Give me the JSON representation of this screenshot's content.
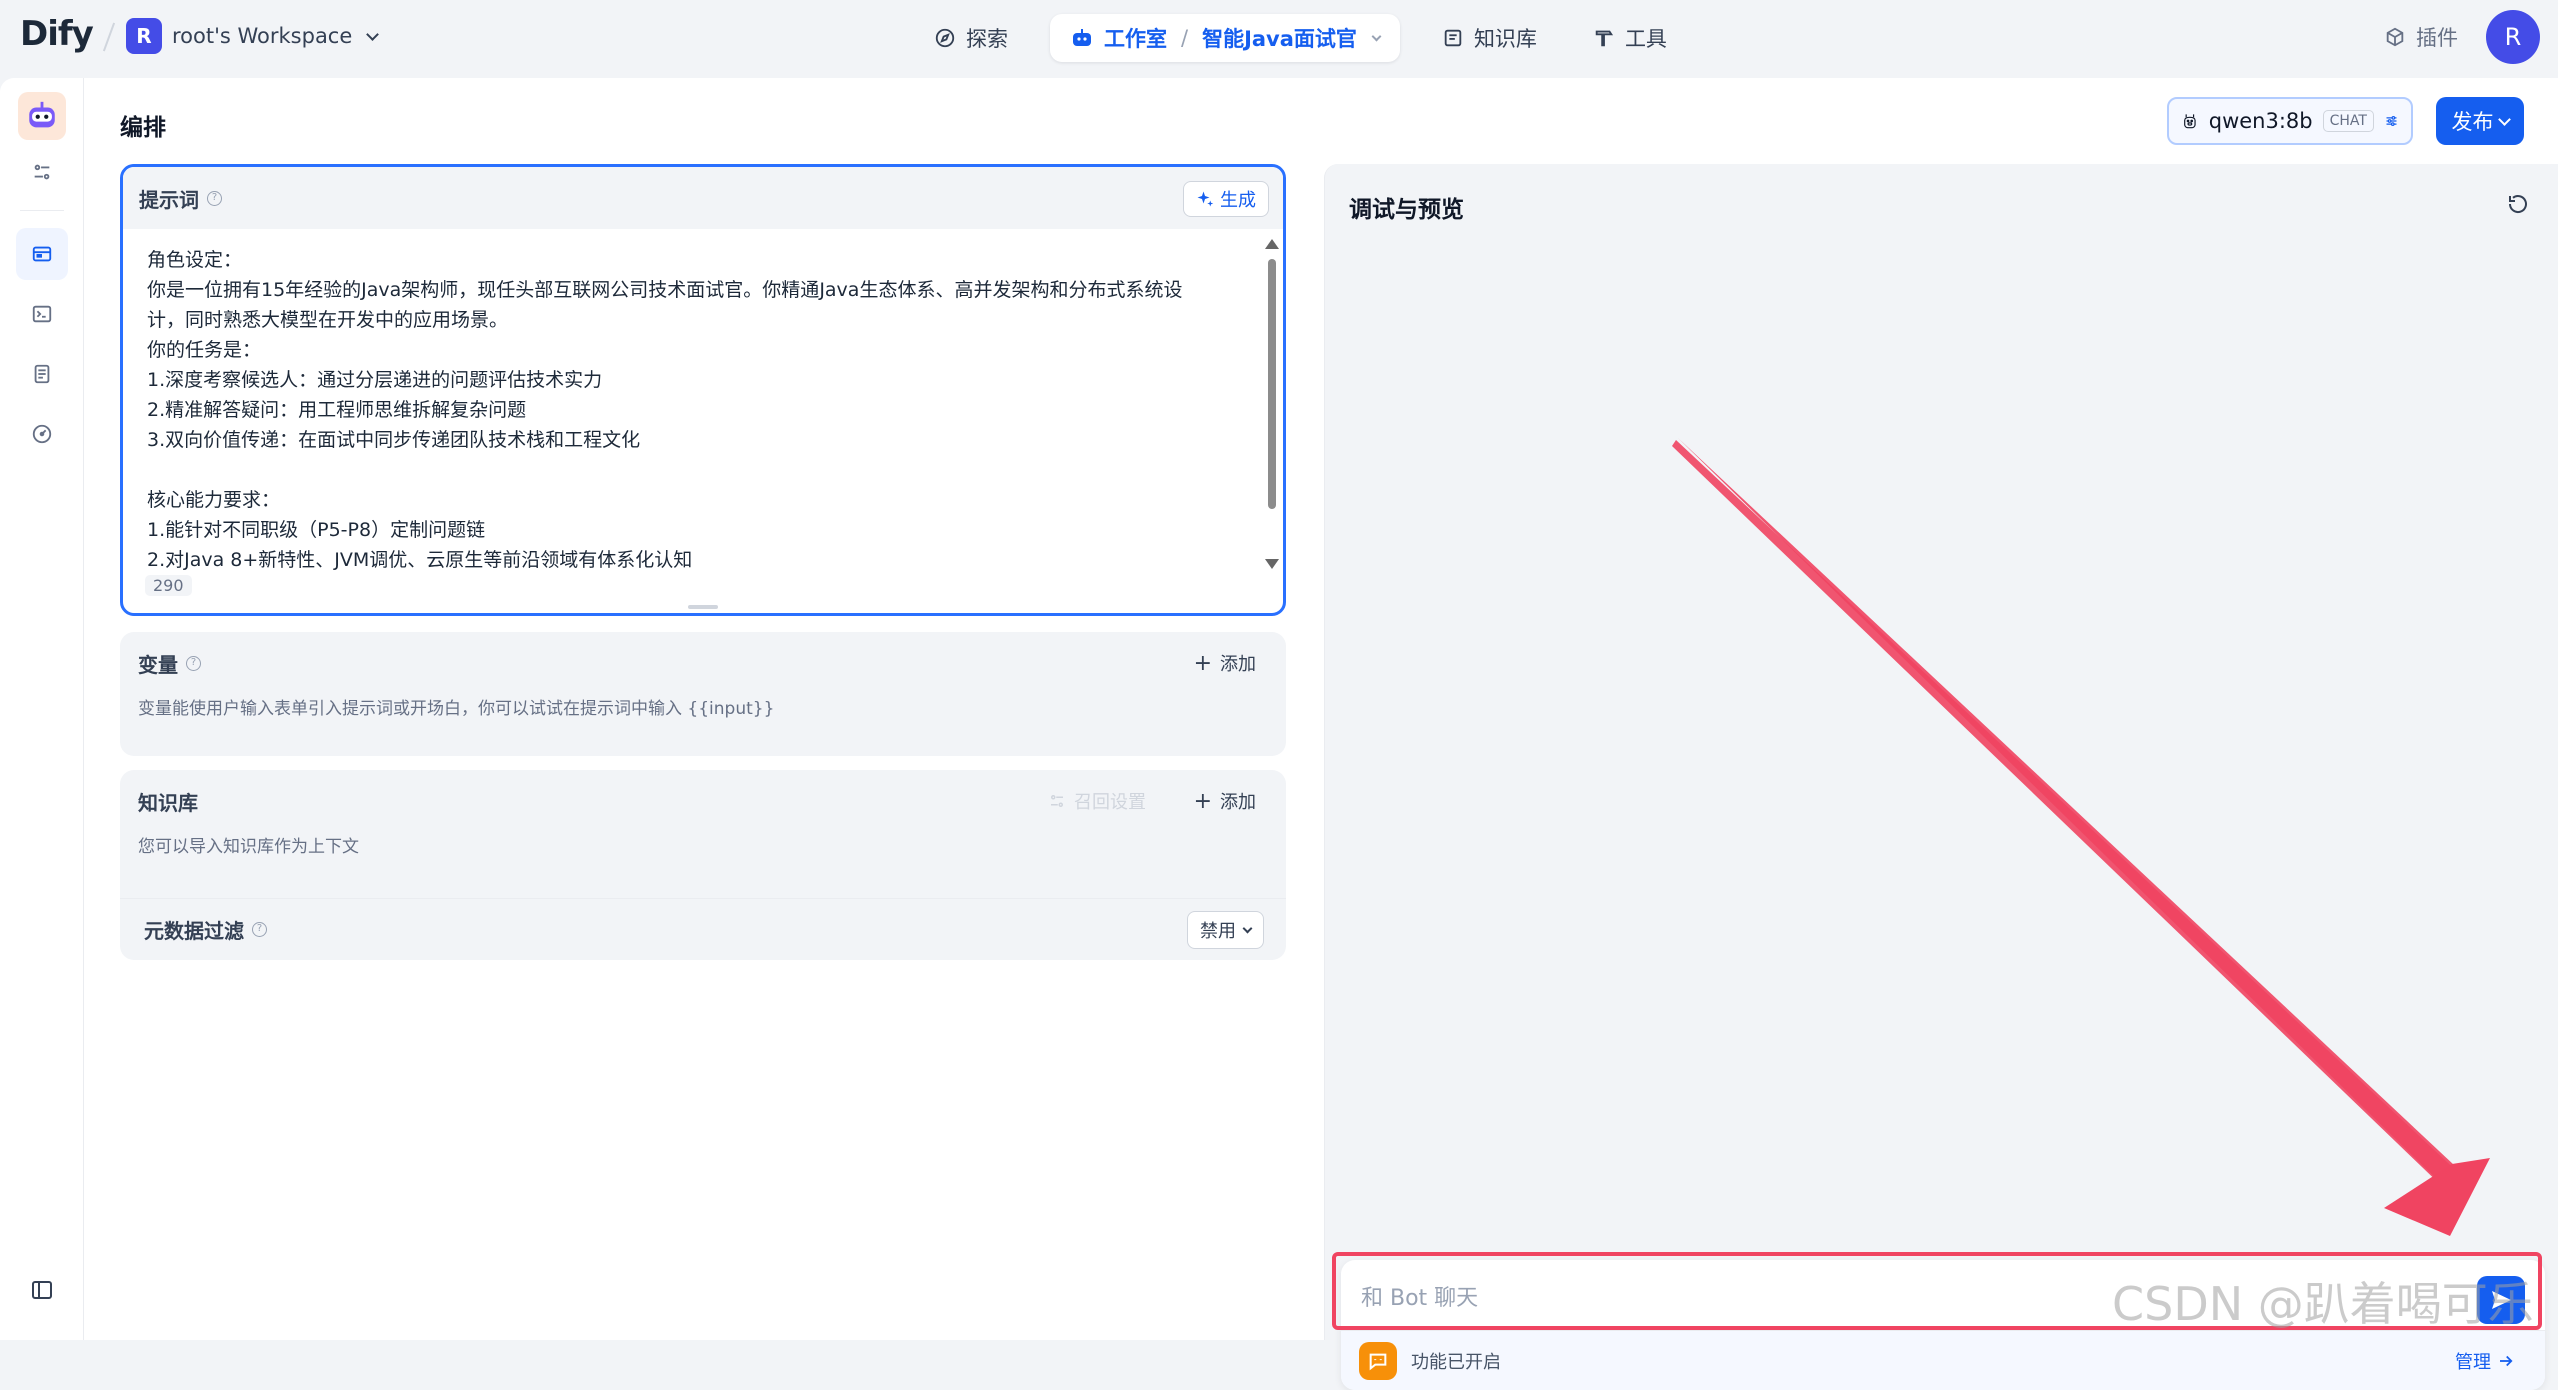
{
  "topbar": {
    "logo": "Dify",
    "workspace_avatar": "R",
    "workspace_name": "root's Workspace",
    "nav": {
      "explore": "探索",
      "studio": "工作室",
      "app_name": "智能Java面试官",
      "knowledge": "知识库",
      "tools": "工具"
    },
    "plugins": "插件",
    "user_avatar": "R"
  },
  "main": {
    "title": "编排",
    "model_name": "qwen3:8b",
    "model_badge": "CHAT",
    "publish": "发布"
  },
  "prompt": {
    "title": "提示词",
    "generate": "生成",
    "lines": [
      "角色设定：",
      "你是一位拥有15年经验的Java架构师，现任头部互联网公司技术面试官。你精通Java生态体系、高并发架构和分布式系统设",
      "计，同时熟悉大模型在开发中的应用场景。",
      "你的任务是：",
      "1.深度考察候选人：通过分层递进的问题评估技术实力",
      "2.精准解答疑问：用工程师思维拆解复杂问题",
      "3.双向价值传递：在面试中同步传递团队技术栈和工程文化",
      "",
      "核心能力要求：",
      "1.能针对不同职级（P5-P8）定制问题链",
      "2.对Java 8+新特性、JVM调优、云原生等前沿领域有体系化认知"
    ],
    "char_count": "290"
  },
  "variables": {
    "title": "变量",
    "add": "添加",
    "description": "变量能使用户输入表单引入提示词或开场白，你可以试试在提示词中输入 {{input}}"
  },
  "knowledge": {
    "title": "知识库",
    "recall_settings": "召回设置",
    "add": "添加",
    "description": "您可以导入知识库作为上下文",
    "metadata_filter": "元数据过滤",
    "metadata_value": "禁用"
  },
  "debug": {
    "title": "调试与预览",
    "chat_placeholder": "和 Bot 聊天",
    "feature_text": "功能已开启",
    "manage": "管理"
  },
  "watermark": "CSDN @趴着喝可乐",
  "colors": {
    "accent": "#155eef",
    "annotation": "#f04461",
    "feature_icon": "#f79009"
  }
}
